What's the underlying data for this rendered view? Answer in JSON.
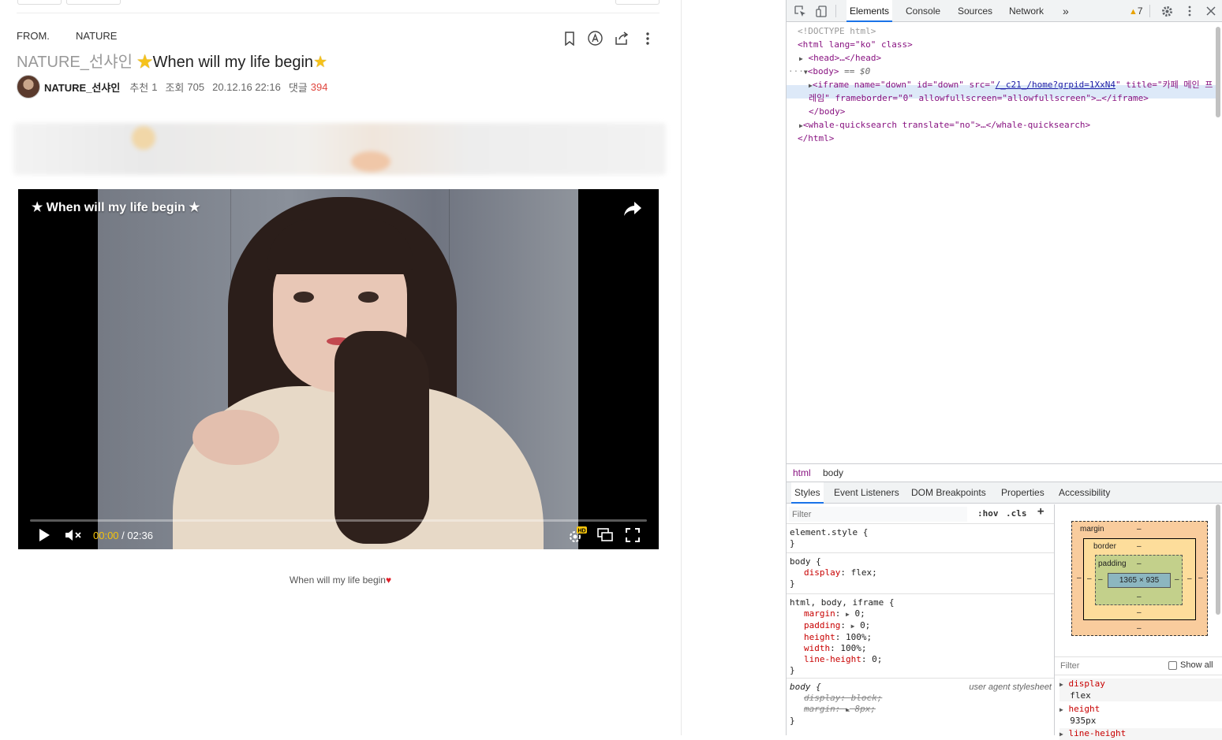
{
  "post": {
    "from_label": "FROM.",
    "from_value": "NATURE",
    "board_name": "NATURE_선샤인",
    "star": "★",
    "title": "When will my life begin",
    "author": "NATURE_선샤인",
    "recommend_label": "추천",
    "recommend_count": "1",
    "views_label": "조회",
    "views_count": "705",
    "datetime": "20.12.16 22:16",
    "comments_label": "댓글",
    "comments_count": "394",
    "actions": [
      "bookmark-icon",
      "translate-icon",
      "share-icon",
      "more-icon"
    ]
  },
  "video": {
    "title": "★ When will my life begin ★",
    "current_time": "00:00",
    "separator": "/",
    "duration": "02:36",
    "progress_fraction": 0.0,
    "hd_label": "HD",
    "controls": [
      "play-icon",
      "volume-icon",
      "settings-icon",
      "pip-icon",
      "fullscreen-icon"
    ]
  },
  "caption": {
    "text": "When will my life begin",
    "heart": "♥"
  },
  "devtools": {
    "tabs": [
      "Elements",
      "Console",
      "Sources",
      "Network"
    ],
    "active_tab": "Elements",
    "more_tabs": "»",
    "warnings_count": "7",
    "dom": {
      "doctype": "<!DOCTYPE html>",
      "html_open": "<html lang=\"ko\" class>",
      "head": "<head>…</head>",
      "body_marker": "== $0",
      "iframe_line1_pre": "<iframe name=\"down\" id=\"down\" src=\"",
      "iframe_src": "/_c21_/home?grpid=1XxN4",
      "iframe_line1_post": "\" title=\"카페 메인 프",
      "iframe_line2": "레임\" frameborder=\"0\" allowfullscreen=\"allowfullscreen\">…</iframe>",
      "body_close": "</body>",
      "whale": "<whale-quicksearch translate=\"no\">…</whale-quicksearch>",
      "html_close": "</html>"
    },
    "breadcrumbs": [
      "html",
      "body"
    ],
    "subtabs": [
      "Styles",
      "Event Listeners",
      "DOM Breakpoints",
      "Properties",
      "Accessibility"
    ],
    "styles": {
      "filter_placeholder": "Filter",
      "hov": ":hov",
      "cls": ".cls",
      "plus": "+",
      "rules": [
        {
          "selector": "element.style {",
          "props": [],
          "close": "}"
        },
        {
          "selector": "body {",
          "props": [
            {
              "name": "display",
              "value": "flex;"
            }
          ],
          "close": "}"
        },
        {
          "selector": "html, body, iframe {",
          "props": [
            {
              "name": "margin",
              "value": "0;"
            },
            {
              "name": "padding",
              "value": "0;"
            },
            {
              "name": "height",
              "value": "100%;"
            },
            {
              "name": "width",
              "value": "100%;"
            },
            {
              "name": "line-height",
              "value": "0;"
            }
          ],
          "close": "}"
        },
        {
          "selector": "body {",
          "source": "user agent stylesheet",
          "props": [
            {
              "name": "display",
              "value": "block;"
            },
            {
              "name": "margin",
              "value": "8px;"
            }
          ],
          "close": "}"
        }
      ]
    },
    "box_model": {
      "margin_label": "margin",
      "border_label": "border",
      "padding_label": "padding",
      "dash": "–",
      "content_size": "1365 × 935"
    },
    "computed": {
      "filter_placeholder": "Filter",
      "show_all": "Show all",
      "items": [
        {
          "name": "display",
          "value": "flex"
        },
        {
          "name": "height",
          "value": "935px"
        },
        {
          "name": "line-height",
          "value": ""
        }
      ]
    }
  }
}
